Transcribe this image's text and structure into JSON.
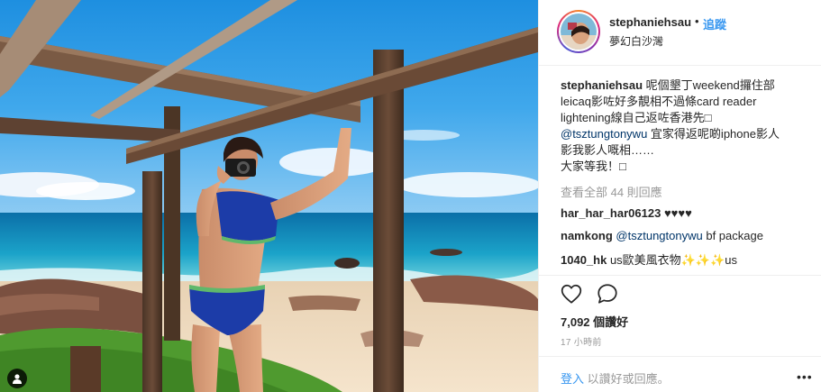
{
  "post": {
    "username": "stephaniehsau",
    "dot": "•",
    "follow_label": "追蹤",
    "location": "夢幻白沙灣"
  },
  "caption": {
    "username": "stephaniehsau",
    "line1": "呢個墾丁weekend攞住部",
    "line2": "leicaq影咗好多靚相不過條card reader",
    "line3": "lightening線自己返咗香港先",
    "mention": "@tsztungtonywu",
    "line4_rest": " 宜家得返呢啲iphone影人",
    "line5": "影我影人嘅相……",
    "line6": "大家等我！"
  },
  "view_all_comments": "查看全部 44 則回應",
  "comments": [
    {
      "username": "har_har_har06123",
      "text": "♥♥♥♥"
    },
    {
      "username": "namkong",
      "mention": "@tsztungtonywu",
      "text": " bf package"
    },
    {
      "username": "1040_hk",
      "text": "us歐美風衣物✨✨✨us"
    }
  ],
  "likes": "7,092 個讚好",
  "time": "17 小時前",
  "login": {
    "link": "登入",
    "rest": " 以讚好或回應。"
  },
  "icons": {
    "like": "heart-outline-icon",
    "comment": "speech-bubble-icon",
    "more": "more-options-icon",
    "user_tag": "user-tag-icon"
  },
  "more_label": "•••",
  "colors": {
    "link_blue": "#3897f0",
    "mention": "#003569",
    "muted": "#999999",
    "sky": "#2b9be0",
    "sea": "#0d7fb6"
  }
}
